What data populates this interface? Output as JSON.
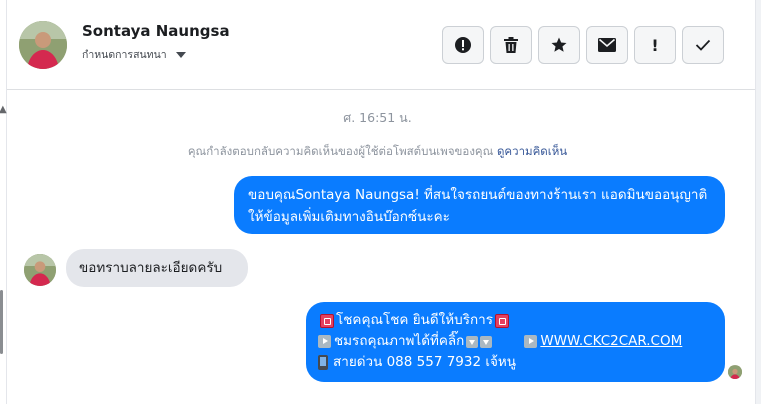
{
  "contact": {
    "name": "Sontaya Naungsa",
    "assign_label": "กำหนดการสนทนา"
  },
  "actions": [
    {
      "name": "report-button",
      "icon": "alert-circle-icon"
    },
    {
      "name": "delete-button",
      "icon": "trash-icon"
    },
    {
      "name": "star-button",
      "icon": "star-icon"
    },
    {
      "name": "unread-button",
      "icon": "envelope-icon"
    },
    {
      "name": "follow-up-button",
      "icon": "exclamation-icon",
      "glyph": "!"
    },
    {
      "name": "done-button",
      "icon": "checkmark-icon"
    }
  ],
  "conversation": {
    "timestamp": "ศ. 16:51 น.",
    "notice_text": "คุณกำลังตอบกลับความคิดเห็นของผู้ใช้ต่อโพสต์บนเพจของคุณ",
    "notice_link": "ดูความคิดเห็น",
    "messages": [
      {
        "direction": "outgoing",
        "text": "ขอบคุณSontaya Naungsa! ที่สนใจรถยนต์ของทางร้านเรา แอดมินขออนุญาติ ให้ข้อมูลเพิ่มเติมทางอินบ๊อกซ์นะคะ"
      },
      {
        "direction": "incoming",
        "text": "ขอทราบลายละเอียดครับ"
      },
      {
        "direction": "outgoing",
        "line1": "โชคคุณโชค ยินดีให้บริการ",
        "line2a": "ชมรถคุณภาพได้ที่คลิ๊ก",
        "line2_link": "WWW.CKC2CAR.COM",
        "line3": "สายด่วน 088 557 7932 เจ้หนู"
      }
    ]
  },
  "colors": {
    "outgoing_bubble": "#0a7cff",
    "incoming_bubble": "#e4e6eb",
    "link": "#385898"
  }
}
